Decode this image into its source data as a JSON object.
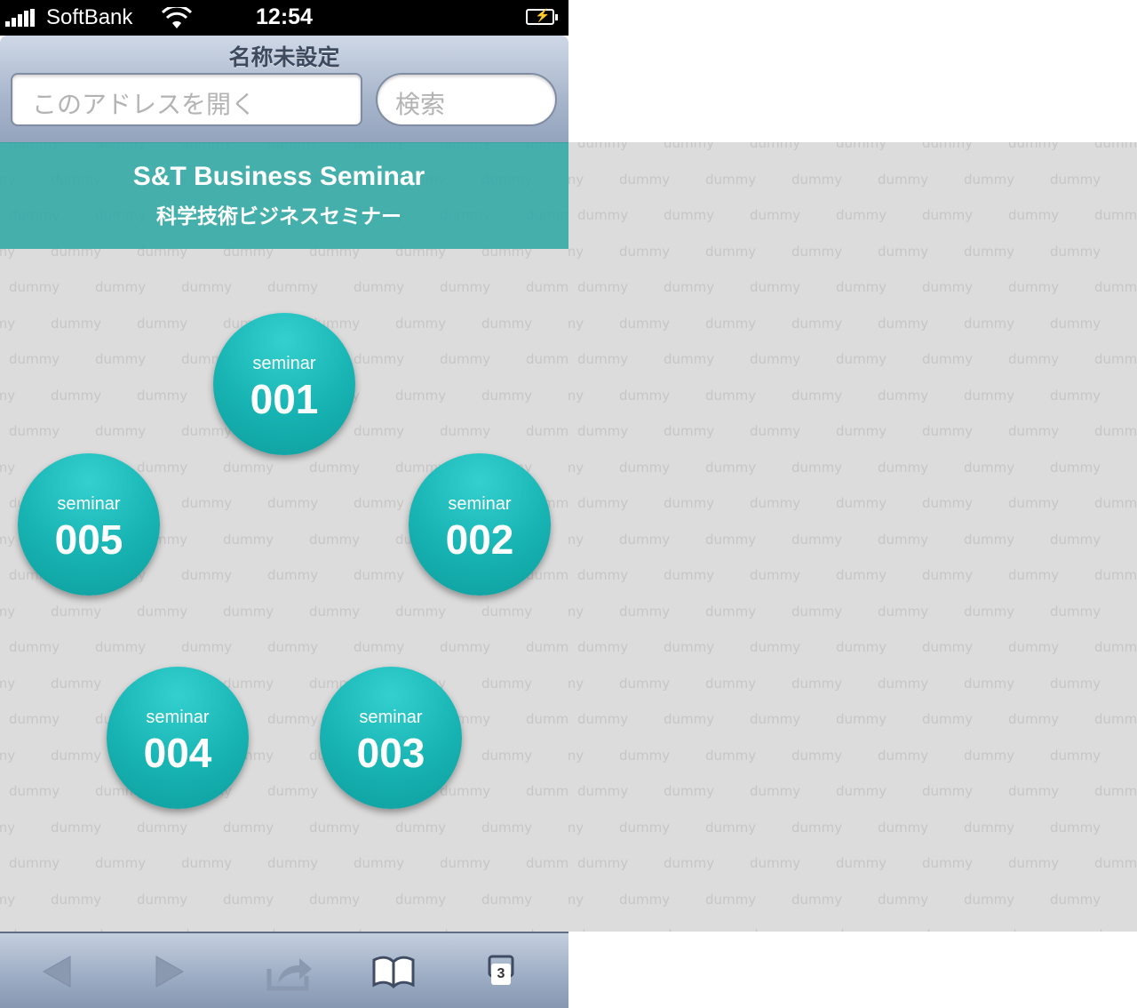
{
  "status_bar": {
    "carrier": "SoftBank",
    "time": "12:54"
  },
  "browser": {
    "page_title": "名称未設定",
    "address_placeholder": "このアドレスを開く",
    "search_placeholder": "検索",
    "tab_count": "3"
  },
  "banner": {
    "title": "S&T Business Seminar",
    "subtitle": "科学技術ビジネスセミナー"
  },
  "background_word": "dummy",
  "seminars": [
    {
      "label": "seminar",
      "number": "001"
    },
    {
      "label": "seminar",
      "number": "002"
    },
    {
      "label": "seminar",
      "number": "003"
    },
    {
      "label": "seminar",
      "number": "004"
    },
    {
      "label": "seminar",
      "number": "005"
    }
  ],
  "colors": {
    "accent": "#30a8a5",
    "circle": "#17b3b2",
    "pattern_bg": "#dcdcdc"
  }
}
